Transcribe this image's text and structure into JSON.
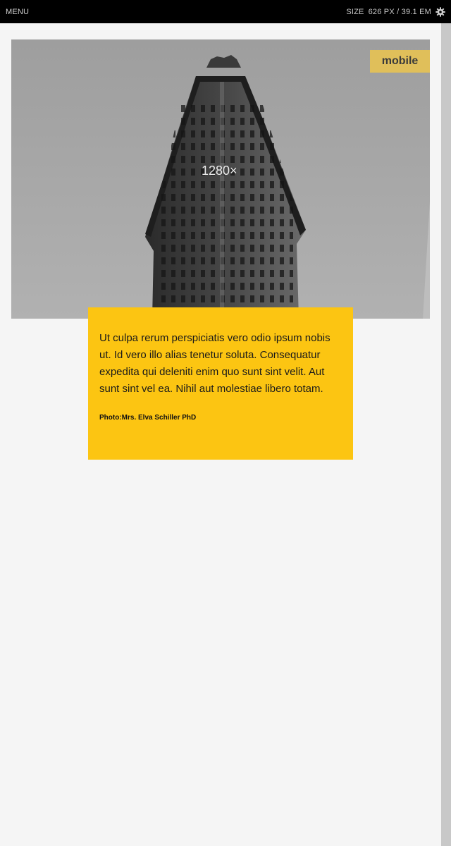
{
  "topbar": {
    "menu_label": "MENU",
    "size_label": "SIZE",
    "size_value": "626 PX / 39.1 EM",
    "settings_icon": "gear-icon"
  },
  "content": {
    "badge": "mobile",
    "image_placeholder_label": "1280×",
    "card": {
      "text": "Ut culpa rerum perspiciatis vero odio ipsum nobis ut. Id vero illo alias tenetur soluta. Consequatur expedita qui deleniti enim quo sunt sint velit. Aut sunt sint vel ea. Nihil aut molestiae libero totam.",
      "credit": "Photo:Mrs. Elva Schiller PhD"
    }
  },
  "colors": {
    "topbar": "#000000",
    "card": "#fcc512",
    "badge": "#e0bf5a"
  }
}
